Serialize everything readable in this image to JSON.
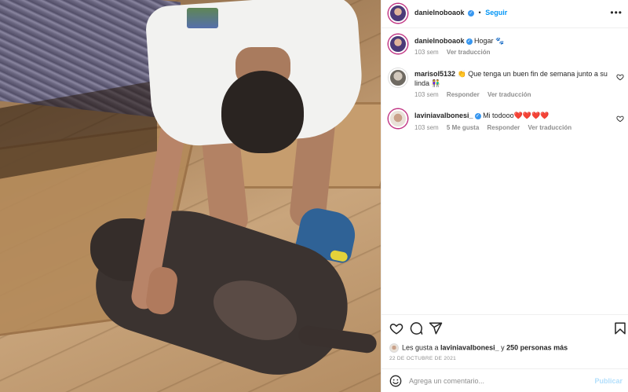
{
  "post": {
    "author": "danielnoboaok",
    "separator": "•",
    "follow_label": "Seguir",
    "more_icon": "more-icon"
  },
  "caption": {
    "username": "danielnoboaok",
    "text": "Hogar 🐾",
    "time": "103 sem",
    "translate": "Ver traducción"
  },
  "comments": [
    {
      "username": "marisol5132",
      "verified": false,
      "text": "👏 Que tenga un buen fin de semana junto a su linda 👫",
      "time": "103 sem",
      "reply": "Responder",
      "translate": "Ver traducción"
    },
    {
      "username": "laviniavalbonesi_",
      "verified": true,
      "text": "Mi todooo❤️❤️❤️❤️",
      "time": "103 sem",
      "likes": "5 Me gusta",
      "reply": "Responder",
      "translate": "Ver traducción"
    }
  ],
  "actions": {
    "icons": [
      "heart-icon",
      "comment-icon",
      "share-icon",
      "bookmark-icon"
    ]
  },
  "likes": {
    "prefix": "Les gusta a ",
    "user": "laviniavalbonesi_",
    "middle": " y ",
    "others": "250 personas más"
  },
  "date": "22 DE OCTUBRE DE 2021",
  "add_comment": {
    "placeholder": "Agrega un comentario...",
    "publish_label": "Publicar",
    "emoji_icon": "emoji-icon"
  },
  "colors": {
    "accent": "#0095f6",
    "verified": "#3897f0",
    "muted": "#8e8e8e",
    "heart_red": "#ed4956"
  }
}
